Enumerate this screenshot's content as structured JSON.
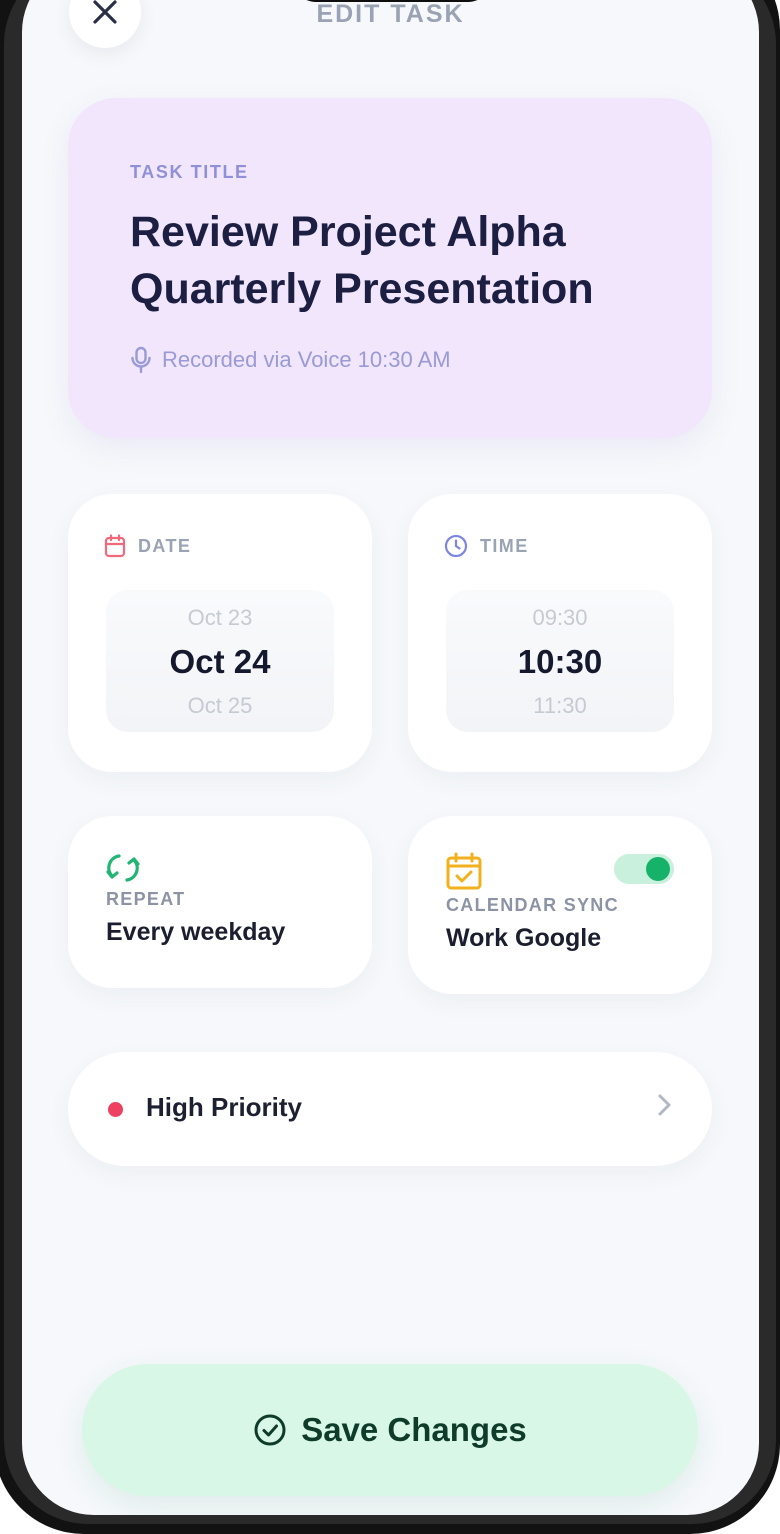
{
  "header": {
    "title": "EDIT TASK",
    "close_icon": "close-icon"
  },
  "task": {
    "label": "TASK TITLE",
    "title": "Review Project Alpha Quarterly Presentation",
    "voice_note": "Recorded via Voice 10:30 AM",
    "voice_icon": "microphone-icon"
  },
  "date": {
    "label": "DATE",
    "icon": "calendar-icon",
    "prev": "Oct 23",
    "selected": "Oct 24",
    "next": "Oct 25",
    "accent": "#f06a7c"
  },
  "time": {
    "label": "TIME",
    "icon": "clock-icon",
    "prev": "09:30",
    "selected": "10:30",
    "next": "11:30",
    "accent": "#7c86e0"
  },
  "repeat": {
    "label": "REPEAT",
    "value": "Every weekday",
    "icon": "repeat-icon",
    "accent": "#22b573"
  },
  "calendar_sync": {
    "label": "CALENDAR SYNC",
    "value": "Work Google",
    "icon": "calendar-check-icon",
    "enabled": true,
    "accent": "#f2b11c"
  },
  "priority": {
    "label": "High Priority",
    "dot_color": "#ee4060"
  },
  "save": {
    "label": "Save Changes",
    "icon": "check-circle-icon"
  }
}
